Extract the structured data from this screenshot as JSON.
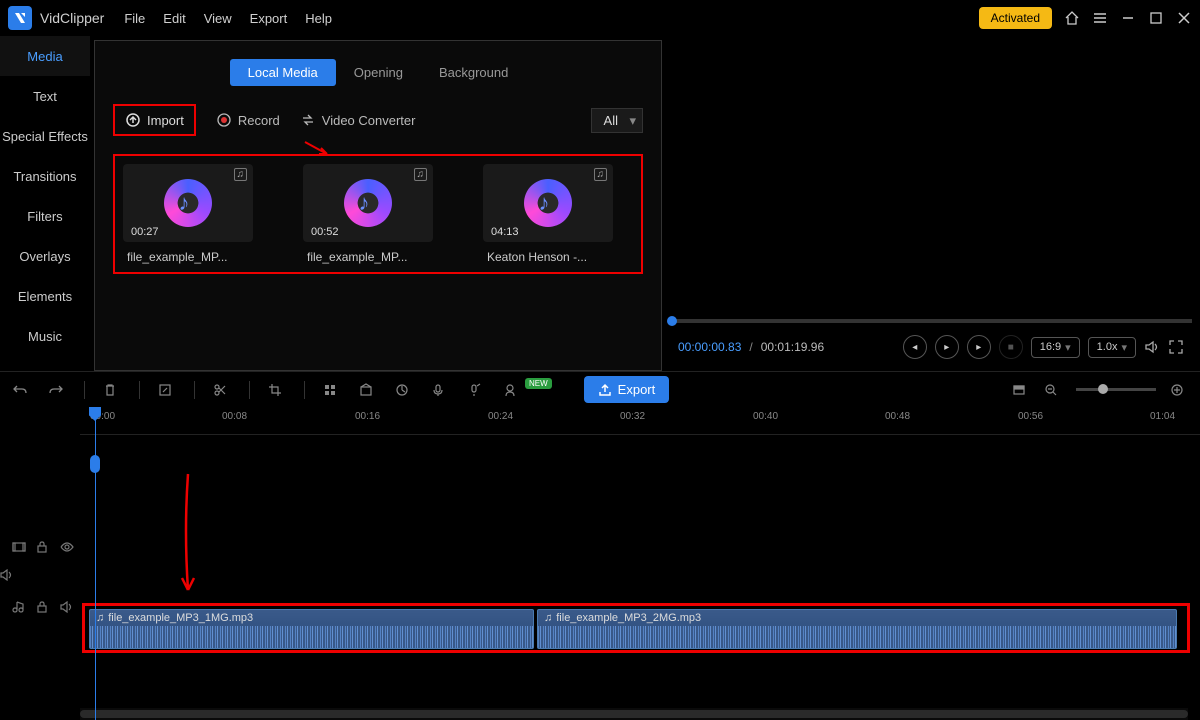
{
  "app": {
    "name": "VidClipper"
  },
  "menu": {
    "file": "File",
    "edit": "Edit",
    "view": "View",
    "export": "Export",
    "help": "Help"
  },
  "titlebar": {
    "activated": "Activated"
  },
  "sidebar": {
    "items": [
      {
        "label": "Media"
      },
      {
        "label": "Text"
      },
      {
        "label": "Special Effects"
      },
      {
        "label": "Transitions"
      },
      {
        "label": "Filters"
      },
      {
        "label": "Overlays"
      },
      {
        "label": "Elements"
      },
      {
        "label": "Music"
      }
    ]
  },
  "tabs": {
    "local": "Local Media",
    "opening": "Opening",
    "background": "Background"
  },
  "actions": {
    "import": "Import",
    "record": "Record",
    "converter": "Video Converter"
  },
  "filter": {
    "selected": "All"
  },
  "media": [
    {
      "duration": "00:27",
      "name": "file_example_MP..."
    },
    {
      "duration": "00:52",
      "name": "file_example_MP..."
    },
    {
      "duration": "04:13",
      "name": "Keaton Henson -..."
    }
  ],
  "preview": {
    "current": "00:00:00.83",
    "total": "00:01:19.96",
    "aspect": "16:9",
    "speed": "1.0x"
  },
  "toolbar": {
    "export": "Export",
    "new": "NEW"
  },
  "ruler": [
    "00:00",
    "00:08",
    "00:16",
    "00:24",
    "00:32",
    "00:40",
    "00:48",
    "00:56",
    "01:04"
  ],
  "clips": [
    {
      "name": "file_example_MP3_1MG.mp3"
    },
    {
      "name": "file_example_MP3_2MG.mp3"
    }
  ]
}
